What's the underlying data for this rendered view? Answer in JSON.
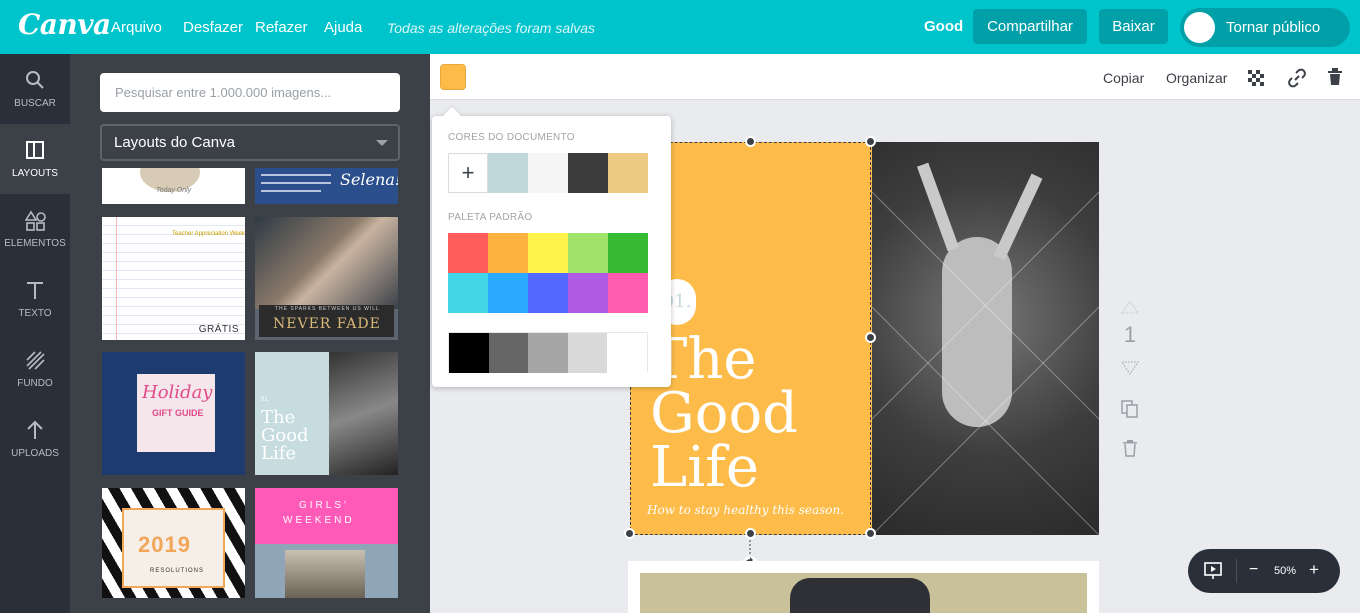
{
  "app": {
    "logo": "Canva"
  },
  "menu": {
    "file": "Arquivo",
    "undo": "Desfazer",
    "redo": "Refazer",
    "help": "Ajuda",
    "saved_status": "Todas as alterações foram salvas"
  },
  "header": {
    "doc_name": "Good",
    "share": "Compartilhar",
    "download": "Baixar",
    "make_public": "Tornar público"
  },
  "nav": {
    "search": "BUSCAR",
    "layouts": "LAYOUTS",
    "elements": "ELEMENTOS",
    "text": "TEXTO",
    "background": "FUNDO",
    "uploads": "UPLOADS"
  },
  "panel": {
    "search_placeholder": "Pesquisar entre 1.000.000 imagens...",
    "dropdown_value": "Layouts do Canva",
    "free_badge": "GRÁTIS",
    "thumbs": {
      "t1": "Today Only",
      "t2": "Selena!",
      "t3": "Teacher Appreciation Week",
      "t4": "NEVER FADE",
      "t4_sub": "THE SPARKS BETWEEN US WILL",
      "t5a": "Holiday",
      "t5b": "GIFT GUIDE",
      "t6a": "The",
      "t6b": "Good",
      "t6c": "Life",
      "t6d": "01.",
      "t7a": "2019",
      "t7b": "RESOLUTIONS",
      "t8a": "GIRLS'",
      "t8b": "WEEKEND"
    }
  },
  "toolbar": {
    "copy": "Copiar",
    "arrange": "Organizar",
    "current_color": "#FDBC49"
  },
  "color_popup": {
    "doc_colors_title": "CORES DO DOCUMENTO",
    "default_palette_title": "PALETA PADRÃO",
    "add_label": "+",
    "doc_colors": [
      "#C1D8DB",
      "#F5F5F5",
      "#3C3C3C",
      "#EECB82"
    ],
    "palette_row1": [
      "#FF5C5C",
      "#FFB140",
      "#FFF24D",
      "#A1E36A",
      "#36BB32"
    ],
    "palette_row2": [
      "#42D7E6",
      "#2BA8FF",
      "#5467FF",
      "#B05BE5",
      "#FF5CAF"
    ],
    "palette_row3": [
      "#000000",
      "#666666",
      "#A6A6A6",
      "#D9D9D9",
      "#FFFFFF"
    ]
  },
  "design": {
    "badge": "01.",
    "title1": "The",
    "title2": "Good",
    "title3": "Life",
    "subtitle": "How to stay healthy this season."
  },
  "page_nav": {
    "page": "1"
  },
  "zoom": {
    "minus": "−",
    "level": "50%",
    "plus": "+"
  }
}
